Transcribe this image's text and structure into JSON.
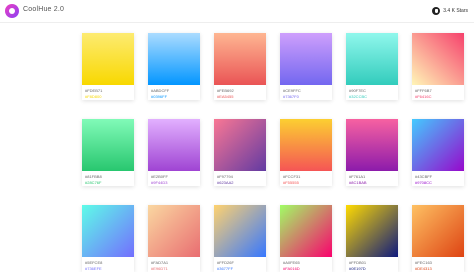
{
  "app": {
    "title": "CoolHue 2.0",
    "stars": "3.4 K Stars"
  },
  "icons": {
    "logo": "coolhue-logo-icon",
    "github": "github-icon"
  },
  "gradients": [
    {
      "from": "#FDEB71",
      "to": "#F8D800",
      "angle": "180deg"
    },
    {
      "from": "#ABDCFF",
      "to": "#0396FF",
      "angle": "180deg"
    },
    {
      "from": "#FEB692",
      "to": "#EA5455",
      "angle": "180deg"
    },
    {
      "from": "#CE9FFC",
      "to": "#7367F0",
      "angle": "180deg"
    },
    {
      "from": "#90F7EC",
      "to": "#32CCBC",
      "angle": "180deg"
    },
    {
      "from": "#FFF6B7",
      "to": "#F6416C",
      "angle": "45deg"
    },
    {
      "from": "#81FBB8",
      "to": "#28C76F",
      "angle": "180deg"
    },
    {
      "from": "#E2B0FF",
      "to": "#9F44D3",
      "angle": "180deg"
    },
    {
      "from": "#F97794",
      "to": "#623AA2",
      "angle": "135deg"
    },
    {
      "from": "#FCCF31",
      "to": "#F55555",
      "angle": "180deg"
    },
    {
      "from": "#F761A1",
      "to": "#8C1BAB",
      "angle": "180deg"
    },
    {
      "from": "#43CBFF",
      "to": "#9708CC",
      "angle": "135deg"
    },
    {
      "from": "#5EFCE8",
      "to": "#736EFE",
      "angle": "135deg"
    },
    {
      "from": "#FAD7A1",
      "to": "#E96D71",
      "angle": "135deg"
    },
    {
      "from": "#FFD26F",
      "to": "#3677FF",
      "angle": "135deg"
    },
    {
      "from": "#A0FE65",
      "to": "#FA016D",
      "angle": "135deg"
    },
    {
      "from": "#FFDB01",
      "to": "#0E197D",
      "angle": "135deg"
    },
    {
      "from": "#FEC163",
      "to": "#DE4313",
      "angle": "135deg"
    }
  ]
}
